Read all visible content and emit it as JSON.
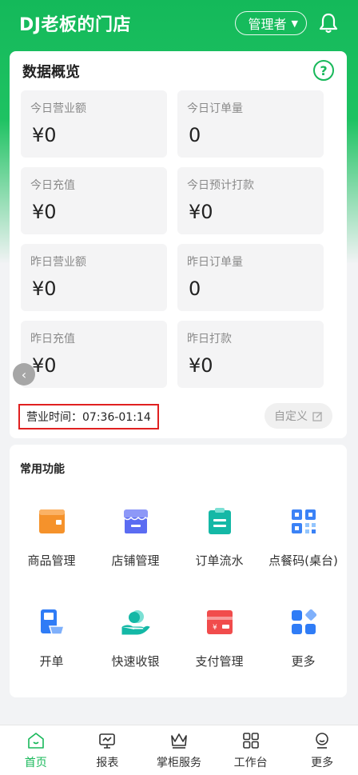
{
  "header": {
    "title": "DJ老板的门店",
    "role": "管理者"
  },
  "overview": {
    "title": "数据概览",
    "stats": [
      {
        "label": "今日营业额",
        "value": "¥0"
      },
      {
        "label": "今日订单量",
        "value": "0"
      },
      {
        "label": "今日充值",
        "value": "¥0"
      },
      {
        "label": "今日预计打款",
        "value": "¥0"
      },
      {
        "label": "昨日营业额",
        "value": "¥0"
      },
      {
        "label": "昨日订单量",
        "value": "0"
      },
      {
        "label": "昨日充值",
        "value": "¥0"
      },
      {
        "label": "昨日打款",
        "value": "¥0"
      }
    ],
    "hours": "营业时间：07:36-01:14",
    "custom_label": "自定义"
  },
  "functions": {
    "title": "常用功能",
    "items": [
      {
        "label": "商品管理",
        "icon": "wallet-icon",
        "color": "#f5922b"
      },
      {
        "label": "店铺管理",
        "icon": "store-icon",
        "color": "#5b6cf2"
      },
      {
        "label": "订单流水",
        "icon": "clipboard-icon",
        "color": "#14b8a6"
      },
      {
        "label": "点餐码(桌台)",
        "icon": "qrcode-icon",
        "color": "#3b82f6"
      },
      {
        "label": "开单",
        "icon": "cashier-icon",
        "color": "#2f7cf6"
      },
      {
        "label": "快速收银",
        "icon": "hand-coin-icon",
        "color": "#14b8a6"
      },
      {
        "label": "支付管理",
        "icon": "card-icon",
        "color": "#f14c4c"
      },
      {
        "label": "更多",
        "icon": "apps-icon",
        "color": "#2f7cf6"
      }
    ]
  },
  "tabbar": {
    "items": [
      {
        "label": "首页",
        "icon": "home-icon",
        "active": true
      },
      {
        "label": "报表",
        "icon": "report-icon"
      },
      {
        "label": "掌柜服务",
        "icon": "crown-icon"
      },
      {
        "label": "工作台",
        "icon": "grid-icon"
      },
      {
        "label": "更多",
        "icon": "user-more-icon"
      }
    ]
  },
  "colors": {
    "brand": "#18b85a",
    "highlight_border": "#e02020"
  }
}
